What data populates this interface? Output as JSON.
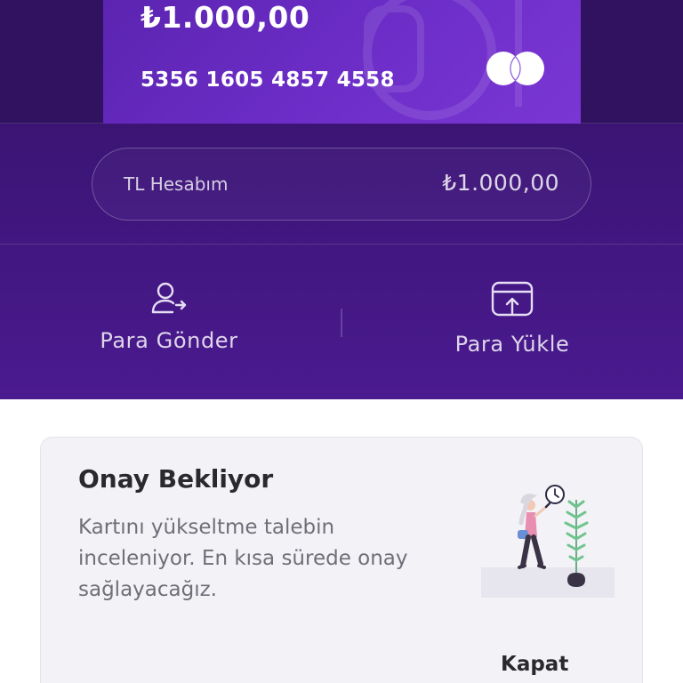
{
  "card": {
    "balance": "₺1.000,00",
    "number": "5356 1605 4857 4558",
    "network_icon": "mastercard-logo"
  },
  "account": {
    "label": "TL Hesabım",
    "balance": "₺1.000,00"
  },
  "actions": {
    "send": {
      "label": "Para Gönder",
      "icon": "user-send-icon"
    },
    "load": {
      "label": "Para Yükle",
      "icon": "upload-card-icon"
    }
  },
  "notice": {
    "title": "Onay Bekliyor",
    "body": "Kartını yükseltme talebin inceleniyor. En kısa sürede onay sağlayacağız.",
    "close_label": "Kapat",
    "illustration": "woman-waiting-with-clock-and-plant"
  },
  "colors": {
    "primary": "#4a1a8f",
    "card": "#6c2dc7",
    "notice_bg": "#f3f2f7",
    "text_dark": "#2a2a2e",
    "text_muted": "#6f6f78"
  }
}
